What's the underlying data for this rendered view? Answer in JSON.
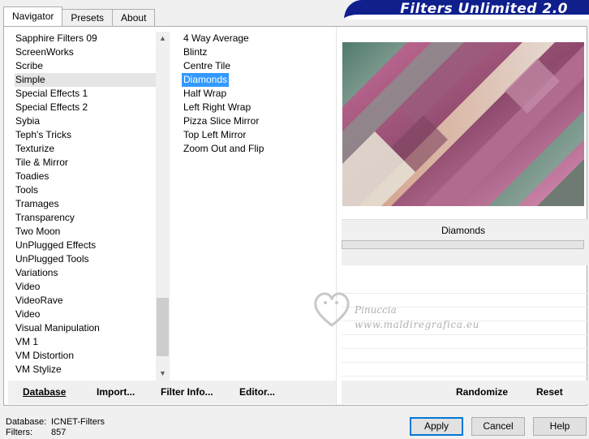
{
  "tabs": [
    "Navigator",
    "Presets",
    "About"
  ],
  "banner_title": "Filters Unlimited 2.0",
  "categories": [
    "Sapphire Filters 09",
    "ScreenWorks",
    "Scribe",
    "Simple",
    "Special Effects 1",
    "Special Effects 2",
    "Sybia",
    "Teph's Tricks",
    "Texturize",
    "Tile & Mirror",
    "Toadies",
    "Tools",
    "Tramages",
    "Transparency",
    "Two Moon",
    "UnPlugged Effects",
    "UnPlugged Tools",
    "Variations",
    "Video",
    "VideoRave",
    "Video",
    "Visual Manipulation",
    "VM 1",
    "VM Distortion",
    "VM Stylize"
  ],
  "selected_category": "Simple",
  "filters": [
    "4 Way Average",
    "Blintz",
    "Centre Tile",
    "Diamonds",
    "Half Wrap",
    "Left Right Wrap",
    "Pizza Slice Mirror",
    "Top Left Mirror",
    "Zoom Out and Flip"
  ],
  "selected_filter": "Diamonds",
  "filter_name": "Diamonds",
  "watermark": {
    "name": "Pinuccia",
    "site": "www.maldiregrafica.eu"
  },
  "left_buttons": {
    "database": "Database",
    "import": "Import...",
    "filter_info": "Filter Info...",
    "editor": "Editor..."
  },
  "right_buttons": {
    "randomize": "Randomize",
    "reset": "Reset"
  },
  "status": {
    "database_label": "Database:",
    "database_value": "ICNET-Filters",
    "filters_label": "Filters:",
    "filters_value": "857"
  },
  "dialog_buttons": {
    "apply": "Apply",
    "cancel": "Cancel",
    "help": "Help"
  },
  "colors": {
    "selection": "#3399ff",
    "banner": "#0f1f8c",
    "default_button_border": "#0078d7"
  },
  "icons": {
    "scroll_up": "chevron-up-icon",
    "scroll_down": "chevron-down-icon",
    "watermark": "heart-logo-icon"
  }
}
